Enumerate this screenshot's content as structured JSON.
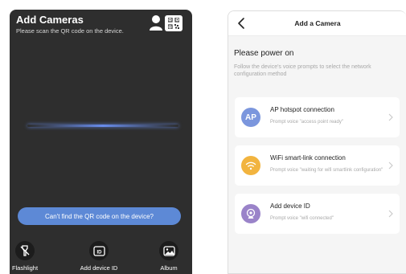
{
  "scanner": {
    "title": "Add Cameras",
    "subtitle": "Please scan the QR code on the device.",
    "top_icons": [
      "person-icon",
      "qr-code-icon"
    ],
    "find_button": "Can't find the QR code on the device?",
    "tools": [
      {
        "label": "Flashlight",
        "icon": "flashlight-off-icon"
      },
      {
        "label": "Add device ID",
        "icon": "id-card-icon"
      },
      {
        "label": "Album",
        "icon": "image-icon"
      }
    ]
  },
  "add_camera": {
    "title": "Add a Camera",
    "power_title": "Please power on",
    "power_desc": "Follow the device's voice prompts to select the network configuration method",
    "options": [
      {
        "title": "AP hotspot connection",
        "desc": "Prompt voice \"access point ready\"",
        "icon_text": "AP",
        "icon": "ap-icon",
        "color": "#7b96dd"
      },
      {
        "title": "WiFi smart-link connection",
        "desc": "Prompt voice \"waiting for wifi smartlink configuration\"",
        "icon": "wifi-icon",
        "color": "#f2b43f"
      },
      {
        "title": "Add device ID",
        "desc": "Prompt voice \"wifi connected\"",
        "icon": "camera-id-icon",
        "color": "#9a83c9"
      }
    ]
  },
  "colors": {
    "scanner_bg": "#2e2e2e",
    "accent": "#5d89d6",
    "panel_bg": "#f5f5f5"
  }
}
